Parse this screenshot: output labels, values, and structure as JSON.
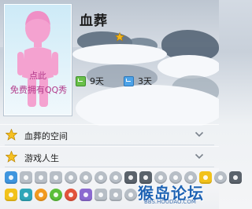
{
  "profile": {
    "username": "血葬",
    "avatar_line1": "点此",
    "avatar_line2": "免费拥有QQ秀"
  },
  "stats": [
    {
      "icon": "green-check-icon",
      "value": "9天"
    },
    {
      "icon": "blue-check-icon",
      "value": "3天"
    }
  ],
  "list": [
    {
      "icon": "star-icon",
      "label": "血葬的空间"
    },
    {
      "icon": "star-icon",
      "label": "游戏人生"
    }
  ],
  "icon_bar": {
    "row1": [
      "diamond-icon",
      "heart-icon",
      "bolt-icon",
      "crown-icon",
      "gem-icon",
      "gem-icon",
      "gem-icon",
      "gem-icon",
      "qq-penguin-icon",
      "qq-penguin-icon",
      "gem-icon",
      "gem-icon",
      "gem-icon",
      "star-icon",
      "gem-icon",
      "qq-penguin-icon"
    ],
    "row2": [
      "pet-icon",
      "qq-2-icon",
      "music-icon",
      "chat-icon",
      "eye-icon",
      "camera-icon",
      "app-icon",
      "mail-icon",
      "shield-icon"
    ]
  },
  "watermark": {
    "text": "猴岛论坛",
    "url": "BBS.HOUDAO.COM"
  },
  "colors": {
    "accent_pink": "#f7a8d4",
    "text": "#1e1e1e",
    "watermark": "#1e63b4"
  }
}
